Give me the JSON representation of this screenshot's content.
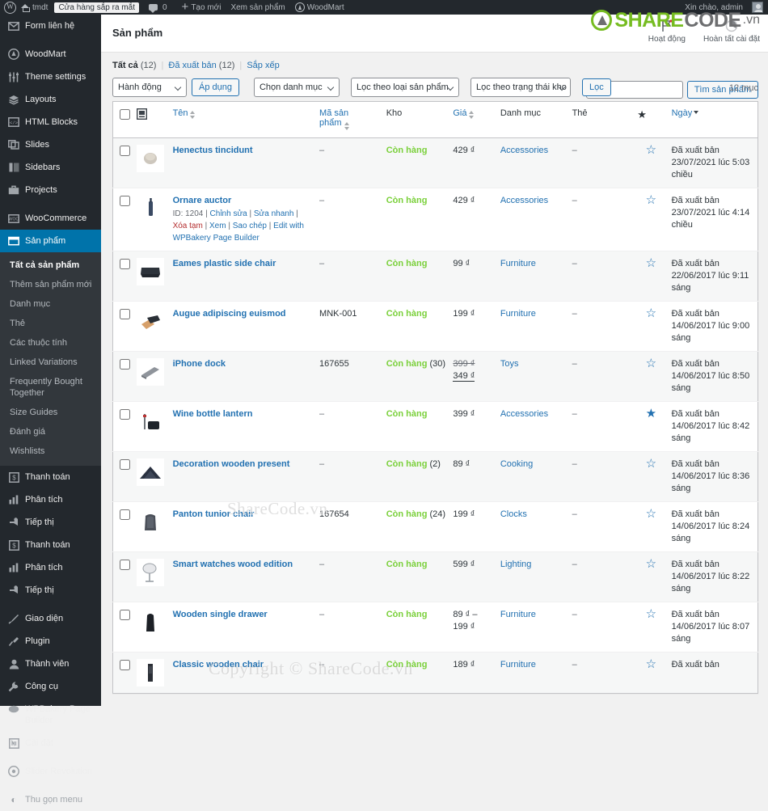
{
  "adminbar": {
    "wp_logo_icon": "wordpress-logo-icon",
    "site_name": "tmdt",
    "coming_soon_badge": "Cửa hàng sắp ra mắt",
    "comments_count": "0",
    "new_label": "Tạo mới",
    "view_shop_label": "Xem sản phẩm",
    "woodmart_label": "WoodMart",
    "howdy": "Xin chào, admin"
  },
  "sidebar": {
    "items": [
      {
        "label": "Form liên hệ",
        "icon": "envelope-icon",
        "current": false,
        "sep_after": true
      },
      {
        "label": "WoodMart",
        "icon": "woodmart-icon",
        "current": false,
        "sep_after": false
      },
      {
        "label": "Theme settings",
        "icon": "sliders-icon",
        "current": false,
        "sep_after": false
      },
      {
        "label": "Layouts",
        "icon": "layers-icon",
        "current": false,
        "sep_after": false
      },
      {
        "label": "HTML Blocks",
        "icon": "code-block-icon",
        "current": false,
        "sep_after": false
      },
      {
        "label": "Slides",
        "icon": "slides-icon",
        "current": false,
        "sep_after": false
      },
      {
        "label": "Sidebars",
        "icon": "sidebar-icon",
        "current": false,
        "sep_after": false
      },
      {
        "label": "Projects",
        "icon": "briefcase-icon",
        "current": false,
        "sep_after": true
      },
      {
        "label": "WooCommerce",
        "icon": "woo-icon",
        "current": false,
        "sep_after": false
      },
      {
        "label": "Sản phẩm",
        "icon": "products-box-icon",
        "current": true,
        "sep_after": false
      }
    ],
    "submenu": [
      {
        "label": "Tất cả sản phẩm",
        "current": true
      },
      {
        "label": "Thêm sản phẩm mới",
        "current": false
      },
      {
        "label": "Danh mục",
        "current": false
      },
      {
        "label": "Thẻ",
        "current": false
      },
      {
        "label": "Các thuộc tính",
        "current": false
      },
      {
        "label": "Linked Variations",
        "current": false
      },
      {
        "label": "Frequently Bought Together",
        "current": false
      },
      {
        "label": "Size Guides",
        "current": false
      },
      {
        "label": "Đánh giá",
        "current": false
      },
      {
        "label": "Wishlists",
        "current": false
      }
    ],
    "items_after": [
      {
        "label": "Thanh toán",
        "icon": "payment-icon",
        "current": false,
        "sep_after": false
      },
      {
        "label": "Phân tích",
        "icon": "analytics-bars-icon",
        "current": false,
        "sep_after": false
      },
      {
        "label": "Tiếp thị",
        "icon": "megaphone-icon",
        "current": false,
        "sep_after": false
      },
      {
        "label": "Thanh toán",
        "icon": "payment-icon",
        "current": false,
        "sep_after": false
      },
      {
        "label": "Phân tích",
        "icon": "analytics-bars-icon",
        "current": false,
        "sep_after": false
      },
      {
        "label": "Tiếp thị",
        "icon": "megaphone-icon",
        "current": false,
        "sep_after": true
      },
      {
        "label": "Giao diện",
        "icon": "appearance-brush-icon",
        "current": false,
        "sep_after": false
      },
      {
        "label": "Plugin",
        "icon": "plugin-icon",
        "current": false,
        "sep_after": false
      },
      {
        "label": "Thành viên",
        "icon": "user-icon",
        "current": false,
        "sep_after": false
      },
      {
        "label": "Công cụ",
        "icon": "wrench-icon",
        "current": false,
        "sep_after": false
      },
      {
        "label": "WPBakery Page Builder",
        "icon": "wpbakery-icon",
        "current": false,
        "sep_after": false
      },
      {
        "label": "Cài đặt",
        "icon": "settings-gear-icon",
        "current": false,
        "sep_after": true
      },
      {
        "label": "Slider Revolution",
        "icon": "slider-revolution-icon",
        "current": false,
        "sep_after": false
      }
    ],
    "collapse_label": "Thu gọn menu",
    "collapse_icon": "collapse-arrow-icon"
  },
  "header": {
    "page_title": "Sản phẩm",
    "icon_buttons": [
      {
        "label": "Hoạt động",
        "icon": "flag-icon"
      },
      {
        "label": "Hoàn tất cài đặt",
        "icon": "progress-circle-icon"
      }
    ]
  },
  "views": {
    "all_label": "Tất cả",
    "all_count": "(12)",
    "published_label": "Đã xuất bản",
    "published_count": "(12)",
    "sort_label": "Sắp xếp"
  },
  "search": {
    "value": "",
    "placeholder": "",
    "button_label": "Tìm sản phẩm"
  },
  "tablenav": {
    "bulk_action_label": "Hành động",
    "apply_label": "Áp dụng",
    "category_filter_label": "Chọn danh mục",
    "product_type_filter_label": "Lọc theo loại sản phẩm",
    "stock_status_filter_label": "Lọc theo trạng thái kho",
    "filter_button_label": "Lọc",
    "displaying_num": "12 mục"
  },
  "table": {
    "columns": {
      "thumb": "",
      "name": "Tên",
      "sku": "Mã sản phẩm",
      "stock": "Kho",
      "price": "Giá",
      "category": "Danh mục",
      "tag": "Thẻ",
      "featured": "★",
      "date": "Ngày"
    },
    "rows": [
      {
        "title": "Henectus tincidunt",
        "sku": "–",
        "stock": "Còn hàng",
        "stock_qty": "",
        "price": "429 ₫",
        "price_old": "",
        "category": "Accessories",
        "tag": "–",
        "featured": false,
        "date_status": "Đã xuất bản",
        "date": "23/07/2021 lúc 5:03 chiều",
        "actions": null
      },
      {
        "title": "Ornare auctor",
        "sku": "–",
        "stock": "Còn hàng",
        "stock_qty": "",
        "price": "429 ₫",
        "price_old": "",
        "category": "Accessories",
        "tag": "–",
        "featured": false,
        "date_status": "Đã xuất bản",
        "date": "23/07/2021 lúc 4:14 chiều",
        "actions": {
          "id_label": "ID: 1204",
          "edit": "Chỉnh sửa",
          "quick_edit": "Sửa nhanh",
          "trash": "Xóa tạm",
          "view": "Xem",
          "duplicate": "Sao chép",
          "edit_with": "Edit with WPBakery Page Builder"
        }
      },
      {
        "title": "Eames plastic side chair",
        "sku": "–",
        "stock": "Còn hàng",
        "stock_qty": "",
        "price": "99 ₫",
        "price_old": "",
        "category": "Furniture",
        "tag": "–",
        "featured": false,
        "date_status": "Đã xuất bản",
        "date": "22/06/2017 lúc 9:11 sáng",
        "actions": null
      },
      {
        "title": "Augue adipiscing euismod",
        "sku": "MNK-001",
        "stock": "Còn hàng",
        "stock_qty": "",
        "price": "199 ₫",
        "price_old": "",
        "category": "Furniture",
        "tag": "–",
        "featured": false,
        "date_status": "Đã xuất bản",
        "date": "14/06/2017 lúc 9:00 sáng",
        "actions": null
      },
      {
        "title": "iPhone dock",
        "sku": "167655",
        "stock": "Còn hàng",
        "stock_qty": "(30)",
        "price": "349 ₫",
        "price_old": "399 ₫",
        "category": "Toys",
        "tag": "–",
        "featured": false,
        "date_status": "Đã xuất bản",
        "date": "14/06/2017 lúc 8:50 sáng",
        "actions": null
      },
      {
        "title": "Wine bottle lantern",
        "sku": "–",
        "stock": "Còn hàng",
        "stock_qty": "",
        "price": "399 ₫",
        "price_old": "",
        "category": "Accessories",
        "tag": "–",
        "featured": true,
        "date_status": "Đã xuất bản",
        "date": "14/06/2017 lúc 8:42 sáng",
        "actions": null
      },
      {
        "title": "Decoration wooden present",
        "sku": "–",
        "stock": "Còn hàng",
        "stock_qty": "(2)",
        "price": "89 ₫",
        "price_old": "",
        "category": "Cooking",
        "tag": "–",
        "featured": false,
        "date_status": "Đã xuất bản",
        "date": "14/06/2017 lúc 8:36 sáng",
        "actions": null
      },
      {
        "title": "Panton tunior chair",
        "sku": "167654",
        "stock": "Còn hàng",
        "stock_qty": "(24)",
        "price": "199 ₫",
        "price_old": "",
        "category": "Clocks",
        "tag": "–",
        "featured": false,
        "date_status": "Đã xuất bản",
        "date": "14/06/2017 lúc 8:24 sáng",
        "actions": null
      },
      {
        "title": "Smart watches wood edition",
        "sku": "–",
        "stock": "Còn hàng",
        "stock_qty": "",
        "price": "599 ₫",
        "price_old": "",
        "category": "Lighting",
        "tag": "–",
        "featured": false,
        "date_status": "Đã xuất bản",
        "date": "14/06/2017 lúc 8:22 sáng",
        "actions": null
      },
      {
        "title": "Wooden single drawer",
        "sku": "–",
        "stock": "Còn hàng",
        "stock_qty": "",
        "price": "89 ₫ – 199 ₫",
        "price_old": "",
        "category": "Furniture",
        "tag": "–",
        "featured": false,
        "date_status": "Đã xuất bản",
        "date": "14/06/2017 lúc 8:07 sáng",
        "actions": null
      },
      {
        "title": "Classic wooden chair",
        "sku": "–",
        "stock": "Còn hàng",
        "stock_qty": "",
        "price": "189 ₫",
        "price_old": "",
        "category": "Furniture",
        "tag": "–",
        "featured": false,
        "date_status": "Đã xuất bản",
        "date": "",
        "actions": null
      }
    ]
  },
  "watermarks": {
    "middle": "ShareCode.vn",
    "bottom": "Copyright © ShareCode.vn",
    "logo_share": "SHARE",
    "logo_code": "CODE",
    "logo_tld": ".vn"
  },
  "colors": {
    "admin_bar": "#23282d",
    "sidebar": "#23282d",
    "submenu": "#32373c",
    "accent_blue": "#0073aa",
    "link_blue": "#2271b1",
    "instock_green": "#7ad03a",
    "trash_red": "#b32d2e",
    "logo_green": "#76bc21"
  }
}
